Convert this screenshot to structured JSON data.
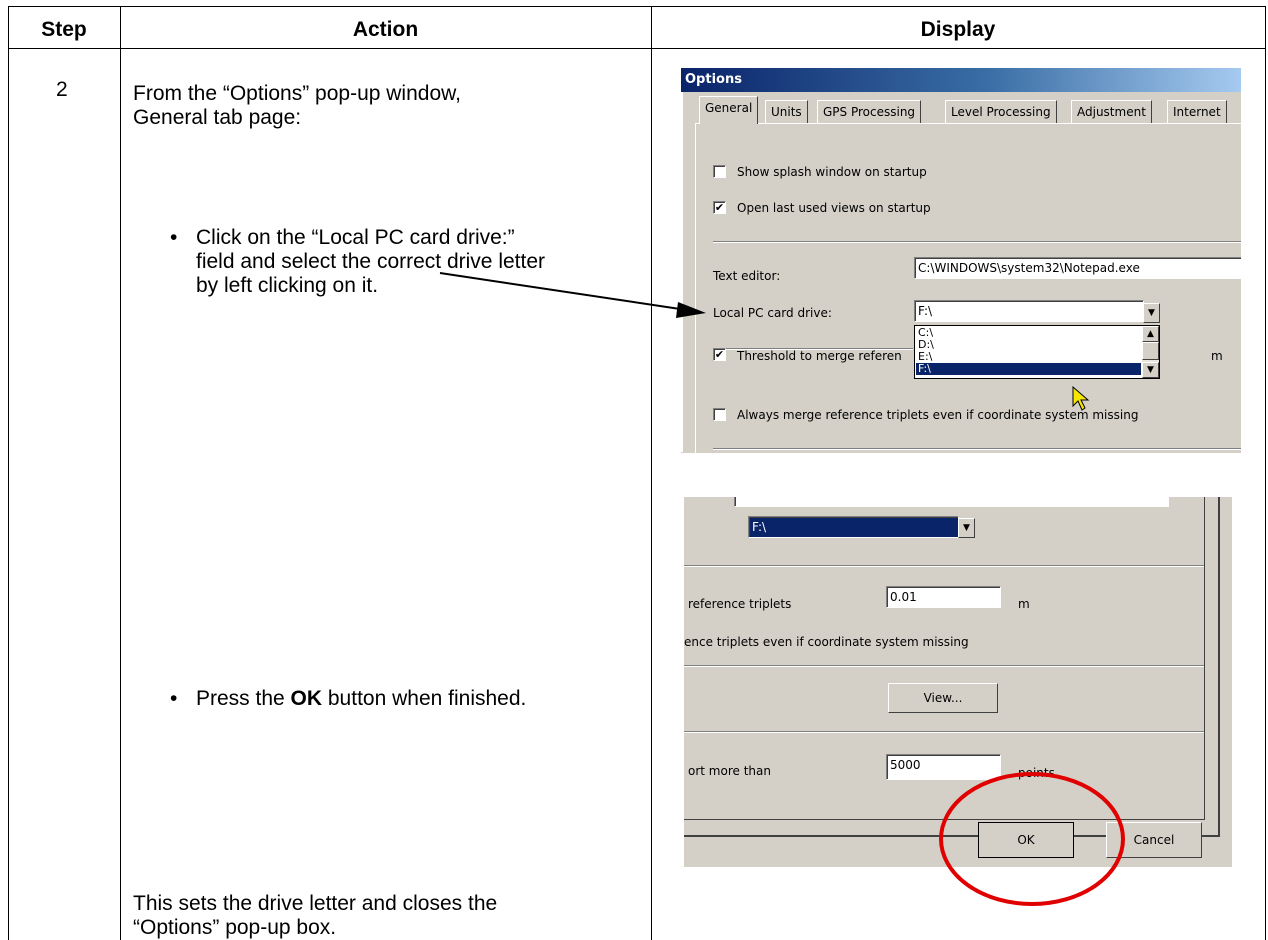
{
  "table": {
    "headers": [
      "Step",
      "Action",
      "Display"
    ],
    "step": "2",
    "action_intro_line1": "From the “Options” pop-up window,",
    "action_intro_line2": "General tab page:",
    "bullet_char": "•",
    "bullet1_line1": "Click on the “Local PC card drive:”",
    "bullet1_line2": "field and select the correct drive letter",
    "bullet1_line3": "by left clicking on it.",
    "bullet2_prefix": "Press the ",
    "bullet2_bold": "OK",
    "bullet2_suffix": " button when finished.",
    "closing_line1": "This sets the drive letter and closes the",
    "closing_line2": "“Options” pop-up box."
  },
  "dialog_top": {
    "title": "Options",
    "tabs": [
      "General",
      "Units",
      "GPS Processing",
      "Level Processing",
      "Adjustment",
      "Internet"
    ],
    "active_tab": "General",
    "show_splash_label": "Show splash window on startup",
    "show_splash_checked": false,
    "open_last_label": "Open last used views on startup",
    "open_last_checked": true,
    "text_editor_label": "Text editor:",
    "text_editor_value": "C:\\WINDOWS\\system32\\Notepad.exe",
    "drive_label": "Local PC card drive:",
    "drive_value": "F:\\",
    "drive_options": [
      "C:\\",
      "D:\\",
      "E:\\",
      "F:\\"
    ],
    "drive_selected": "F:\\",
    "threshold_label": "Threshold to merge referen",
    "threshold_checked": true,
    "threshold_unit": "m",
    "always_merge_label": "Always merge reference triplets even if coordinate system missing",
    "always_merge_checked": false,
    "check_mark": "✔"
  },
  "dialog_bottom": {
    "drive_value": "F:\\",
    "threshold_label": "reference triplets",
    "threshold_value": "0.01",
    "threshold_unit": "m",
    "always_merge_label": "ence triplets even if coordinate system missing",
    "view_button": "View...",
    "report_label": "ort more than",
    "report_value": "5000",
    "report_unit": "points",
    "ok_button": "OK",
    "cancel_button": "Cancel"
  },
  "colors": {
    "titlebar": "#0a246a",
    "selection": "#0a246a",
    "dialog_bg": "#d4d0c8",
    "annotation_circle": "#e00000",
    "cursor": "#f5e600"
  },
  "icons": [
    "dropdown-arrow-icon",
    "scroll-up-icon",
    "scroll-down-icon",
    "mouse-pointer-icon",
    "annotation-arrow-icon"
  ]
}
